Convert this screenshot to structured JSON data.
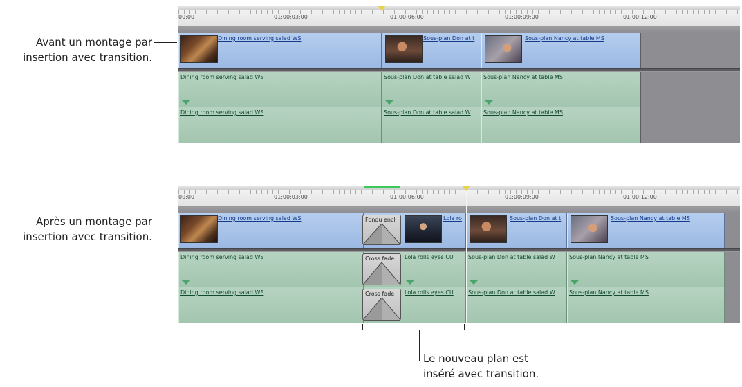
{
  "callouts": {
    "before": {
      "line1": "Avant un montage par",
      "line2": "insertion avec transition."
    },
    "after": {
      "line1": "Après un montage par",
      "line2": "insertion avec transition."
    },
    "result": {
      "line1": "Le nouveau plan est",
      "line2": "inséré avec transition."
    }
  },
  "ruler": {
    "timecodes": [
      "00:00",
      "01:00:03:00",
      "01:00:06:00",
      "01:00:09:00",
      "01:00:12:00"
    ]
  },
  "before": {
    "video": [
      {
        "label": "Dining room serving salad WS",
        "thumb": "dining-room-thumbnail"
      },
      {
        "label": "Sous-plan Don at t",
        "thumb": "don-thumbnail"
      },
      {
        "label": "Sous-plan Nancy at table MS",
        "thumb": "nancy-thumbnail"
      }
    ],
    "audio1": [
      "Dining room serving salad WS",
      "Sous-plan Don at table salad W",
      "Sous-plan Nancy at table MS"
    ],
    "audio2": [
      "Dining room serving salad WS",
      "Sous-plan Don at table salad W",
      "Sous-plan Nancy at table MS"
    ]
  },
  "after": {
    "video": [
      {
        "label": "Dining room serving salad WS",
        "thumb": "dining-room-thumbnail"
      },
      {
        "label": "Lola ro",
        "thumb": "lola-thumbnail"
      },
      {
        "label": "Sous-plan Don at t",
        "thumb": "don-thumbnail"
      },
      {
        "label": "Sous-plan Nancy at table MS",
        "thumb": "nancy-thumbnail"
      }
    ],
    "video_transition": "Fondu encl",
    "audio1": [
      "Dining room serving salad WS",
      "Lola rolls eyes CU",
      "Sous-plan Don at table salad W",
      "Sous-plan Nancy at table MS"
    ],
    "audio2": [
      "Dining room serving salad WS",
      "Lola rolls eyes CU",
      "Sous-plan Don at table salad W",
      "Sous-plan Nancy at table MS"
    ],
    "audio_transition": "Cross fade"
  },
  "colors": {
    "video_clip": "#a8c4ea",
    "audio_clip": "#a9cab6",
    "playhead": "#e8d24a",
    "empty_track": "#8e8e92"
  }
}
